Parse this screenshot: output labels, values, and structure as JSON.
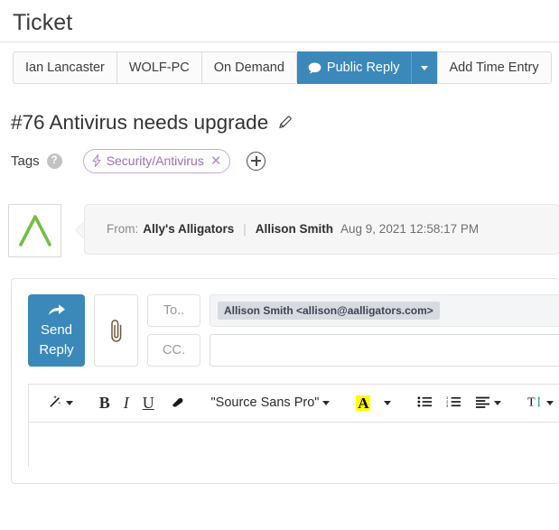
{
  "header": {
    "title": "Ticket"
  },
  "tabbar": {
    "tabs": [
      {
        "label": "Ian Lancaster",
        "kind": "plain",
        "name": "tab-ian-lancaster"
      },
      {
        "label": "WOLF-PC",
        "kind": "plain",
        "name": "tab-wolf-pc"
      },
      {
        "label": "On Demand",
        "kind": "plain",
        "name": "tab-on-demand"
      }
    ],
    "public_reply": {
      "label": "Public Reply",
      "icon": "speech-bubble-icon",
      "caret_icon": "chevron-down-icon",
      "color": "#3b88ba"
    },
    "add_time_entry": {
      "label": "Add Time Entry"
    }
  },
  "ticket": {
    "title": "#76 Antivirus needs upgrade",
    "edit_icon": "pencil-icon",
    "tags_label": "Tags",
    "help_icon": "?",
    "tag": {
      "label": "Security/Antivirus",
      "bolt_icon": "lightning-bolt-icon",
      "remove_icon": "✕",
      "color": "#9b6fb5",
      "border_color": "#c9a8d6"
    },
    "add_tag_icon": "plus-circle-icon"
  },
  "message": {
    "avatar_icon": "alligator-chevron-logo",
    "avatar_color": "#72bf44",
    "from_label": "From:",
    "company": "Ally's Alligators",
    "separator": "|",
    "person": "Allison Smith",
    "date": "Aug 9, 2021 12:58:17 PM"
  },
  "composer": {
    "send_button": {
      "line1": "Send",
      "line2": "Reply",
      "icon": "reply-arrow-icon",
      "color": "#3b88ba"
    },
    "attach_icon": "paperclip-icon",
    "to_button": "To..",
    "cc_button": "CC.",
    "to_value": "Allison Smith <allison@aalligators.com>",
    "cc_value": "",
    "cc_placeholder": ""
  },
  "editor": {
    "toolbar": [
      {
        "name": "format-painter-button",
        "icon": "magic-wand-icon",
        "label": "",
        "caret": true
      },
      {
        "name": "bold-button",
        "icon": "bold-icon",
        "label": "B",
        "caret": false
      },
      {
        "name": "italic-button",
        "icon": "italic-icon",
        "label": "I",
        "caret": false
      },
      {
        "name": "underline-button",
        "icon": "underline-icon",
        "label": "U",
        "caret": false
      },
      {
        "name": "clear-formatting-button",
        "icon": "eraser-icon",
        "label": "",
        "caret": false
      },
      {
        "name": "font-family-select",
        "icon": "",
        "label": "\"Source Sans Pro\"",
        "caret": true
      },
      {
        "name": "highlight-color-button",
        "icon": "highlight-a-icon",
        "label": "A",
        "caret": true
      },
      {
        "name": "bullet-list-button",
        "icon": "bulleted-list-icon",
        "label": "",
        "caret": false
      },
      {
        "name": "numbered-list-button",
        "icon": "numbered-list-icon",
        "label": "",
        "caret": false
      },
      {
        "name": "align-button",
        "icon": "align-left-icon",
        "label": "",
        "caret": true
      },
      {
        "name": "line-height-button",
        "icon": "line-height-icon",
        "label": "",
        "caret": true
      }
    ],
    "body_text": ""
  }
}
